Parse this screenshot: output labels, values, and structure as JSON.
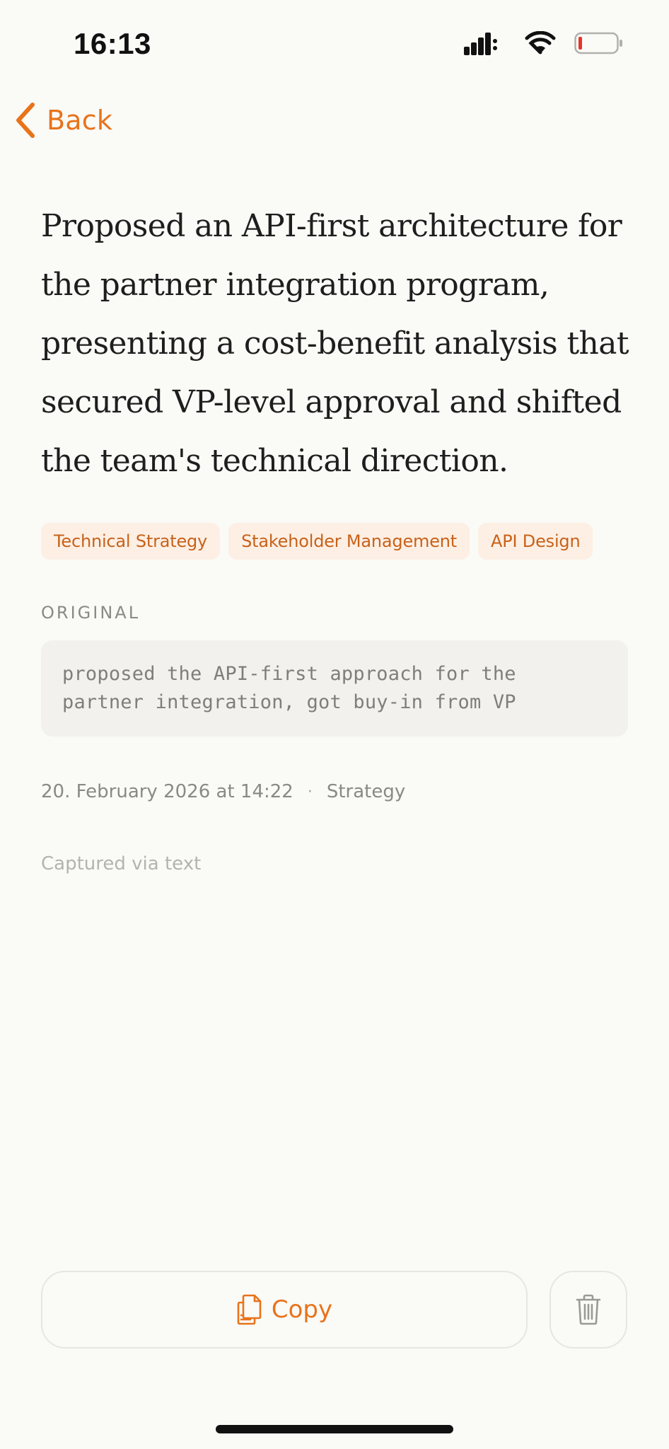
{
  "status_bar": {
    "time": "16:13",
    "icons": [
      "cellular-signal-icon",
      "wifi-icon",
      "battery-low-icon"
    ]
  },
  "nav": {
    "back_label": "Back",
    "back_icon": "chevron-left-icon"
  },
  "entry": {
    "text": "Proposed an API-first architecture for the partner integration program, presenting a cost-benefit analysis that secured VP-level approval and shifted the team's technical direction.",
    "tags": [
      "Technical Strategy",
      "Stakeholder Management",
      "API Design"
    ],
    "original_label": "ORIGINAL",
    "original_text": "proposed the API-first approach for the partner integration, got buy-in from VP",
    "date": "20. February 2026 at 14:22",
    "separator": "·",
    "category": "Strategy",
    "capture_source": "Captured via text"
  },
  "actions": {
    "copy_label": "Copy",
    "copy_icon": "copy-document-icon",
    "delete_icon": "trash-icon"
  },
  "colors": {
    "accent": "#E8731A",
    "tag_background": "#FDEFE4",
    "tag_text": "#C8621A",
    "background": "#FAFAF7",
    "battery_low": "#E5352B"
  }
}
